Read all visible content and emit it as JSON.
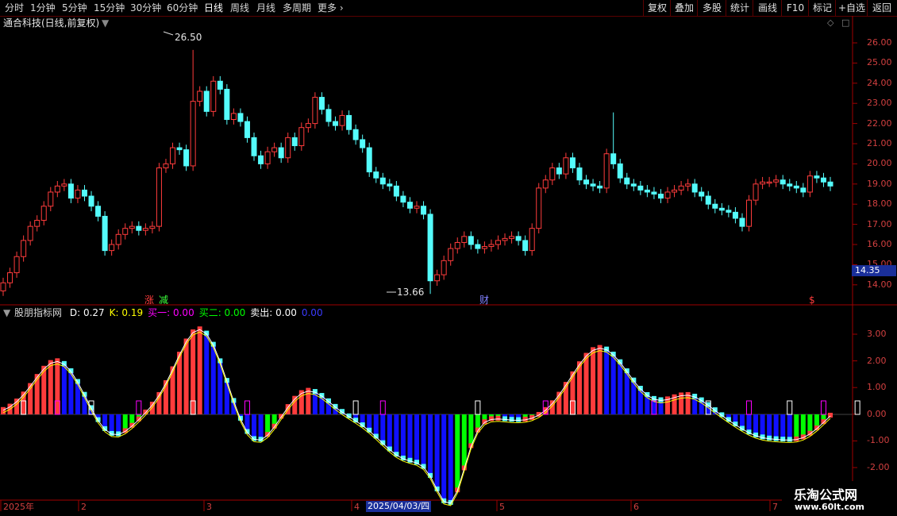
{
  "toolbar": {
    "periods": [
      "分时",
      "1分钟",
      "5分钟",
      "15分钟",
      "30分钟",
      "60分钟",
      "日线",
      "周线",
      "月线",
      "多周期",
      "更多"
    ],
    "active_period": "日线",
    "more_chevron_icon": "chevron-right-icon",
    "right_buttons": [
      "复权",
      "叠加",
      "多股",
      "统计",
      "画线",
      "F10",
      "标记",
      "+自选",
      "返回"
    ]
  },
  "stock": {
    "title": "通合科技(日线,前复权)",
    "high_marker": "26.50",
    "low_marker": "13.66",
    "current_price": "14.35",
    "event_marks": {
      "up": "涨",
      "down": "减",
      "finance": "财",
      "dividend": "$"
    }
  },
  "price_axis": {
    "ticks": [
      "26.00",
      "25.00",
      "24.00",
      "23.00",
      "22.00",
      "21.00",
      "20.00",
      "19.00",
      "18.00",
      "17.00",
      "16.00",
      "15.00",
      "14.00"
    ]
  },
  "indicator": {
    "name": "股朋指标网",
    "fields": [
      {
        "label": "D:",
        "value": "0.27",
        "color": "#ffffff"
      },
      {
        "label": "K:",
        "value": "0.19",
        "color": "#ffff00"
      },
      {
        "label": "买一:",
        "value": "0.00",
        "color": "#ff00ff"
      },
      {
        "label": "买二:",
        "value": "0.00",
        "color": "#00ff00"
      },
      {
        "label": "卖出:",
        "value": "0.00",
        "color": "#ffffff"
      },
      {
        "label": "",
        "value": "0.00",
        "color": "#3a3aff"
      }
    ],
    "axis_ticks": [
      "3.00",
      "2.00",
      "1.00",
      "0.00",
      "-1.00",
      "-2.00"
    ]
  },
  "time_axis": {
    "labels": [
      "2025年",
      "2",
      "3",
      "4",
      "5",
      "6",
      "7"
    ],
    "cursor_date": "2025/04/03/四"
  },
  "watermark": {
    "line1": "乐淘公式网",
    "line2": "www.60lt.com"
  },
  "colors": {
    "up": "#ff3c3c",
    "down": "#54fcfc",
    "grid": "#8b0000",
    "osc_blue": "#1010ff",
    "osc_green": "#00ff00"
  }
}
